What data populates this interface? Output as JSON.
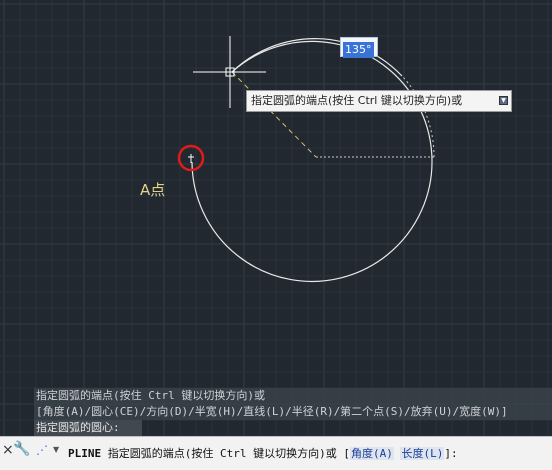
{
  "drawing": {
    "angle_value": "135°",
    "point_label": "A点",
    "tooltip_text": "指定圆弧的端点(按住 Ctrl 键以切换方向)或",
    "tooltip_dropdown_icon": "dropdown-icon"
  },
  "command_history": [
    "指定圆弧的端点(按住 Ctrl 键以切换方向)或",
    "[角度(A)/圆心(CE)/方向(D)/半宽(H)/直线(L)/半径(R)/第二个点(S)/放弃(U)/宽度(W)]",
    "指定圆弧的圆心:"
  ],
  "command_line": {
    "command": "PLINE",
    "prompt": "指定圆弧的端点(按住 Ctrl 键以切换方向)或",
    "bracket_open": "[",
    "option1": "角度(A)",
    "option2": "长度(L)",
    "bracket_close": "]:"
  },
  "colors": {
    "background": "#212830",
    "grid_minor": "#2b323b",
    "grid_major": "#333b45",
    "geometry": "#e8e8e8",
    "highlight_circle": "#e01b1b",
    "label_yellow": "#e3d28a"
  }
}
